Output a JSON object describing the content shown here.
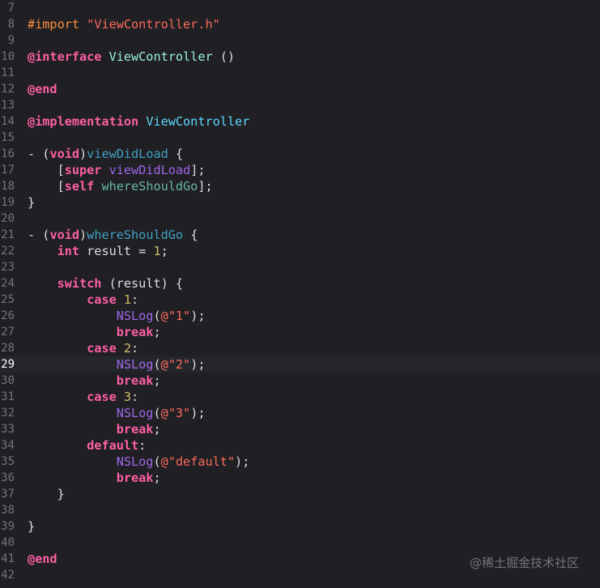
{
  "editor": {
    "current_line": 29,
    "first_line": 7,
    "lines": [
      [],
      [
        {
          "t": "#import ",
          "c": "pp"
        },
        {
          "t": "\"ViewController.h\"",
          "c": "str"
        }
      ],
      [],
      [
        {
          "t": "@interface",
          "c": "kw"
        },
        {
          "t": " ",
          "c": "txt"
        },
        {
          "t": "ViewController",
          "c": "tn"
        },
        {
          "t": " ()",
          "c": "txt"
        }
      ],
      [],
      [
        {
          "t": "@end",
          "c": "kw"
        }
      ],
      [],
      [
        {
          "t": "@implementation",
          "c": "kw"
        },
        {
          "t": " ",
          "c": "txt"
        },
        {
          "t": "ViewController",
          "c": "cls"
        }
      ],
      [],
      [
        {
          "t": "- (",
          "c": "txt"
        },
        {
          "t": "void",
          "c": "kw"
        },
        {
          "t": ")",
          "c": "txt"
        },
        {
          "t": "viewDidLoad",
          "c": "fdecl"
        },
        {
          "t": " {",
          "c": "txt"
        }
      ],
      [
        {
          "t": "    [",
          "c": "txt"
        },
        {
          "t": "super",
          "c": "kw"
        },
        {
          "t": " ",
          "c": "txt"
        },
        {
          "t": "viewDidLoad",
          "c": "sys"
        },
        {
          "t": "];",
          "c": "txt"
        }
      ],
      [
        {
          "t": "    [",
          "c": "txt"
        },
        {
          "t": "self",
          "c": "kw"
        },
        {
          "t": " ",
          "c": "txt"
        },
        {
          "t": "whereShouldGo",
          "c": "proj"
        },
        {
          "t": "];",
          "c": "txt"
        }
      ],
      [
        {
          "t": "}",
          "c": "txt"
        }
      ],
      [],
      [
        {
          "t": "- (",
          "c": "txt"
        },
        {
          "t": "void",
          "c": "kw"
        },
        {
          "t": ")",
          "c": "txt"
        },
        {
          "t": "whereShouldGo",
          "c": "fdecl"
        },
        {
          "t": " {",
          "c": "txt"
        }
      ],
      [
        {
          "t": "    ",
          "c": "txt"
        },
        {
          "t": "int",
          "c": "kw"
        },
        {
          "t": " result = ",
          "c": "txt"
        },
        {
          "t": "1",
          "c": "num"
        },
        {
          "t": ";",
          "c": "txt"
        }
      ],
      [],
      [
        {
          "t": "    ",
          "c": "txt"
        },
        {
          "t": "switch",
          "c": "kw"
        },
        {
          "t": " (result) {",
          "c": "txt"
        }
      ],
      [
        {
          "t": "        ",
          "c": "txt"
        },
        {
          "t": "case",
          "c": "kw"
        },
        {
          "t": " ",
          "c": "txt"
        },
        {
          "t": "1",
          "c": "num"
        },
        {
          "t": ":",
          "c": "txt"
        }
      ],
      [
        {
          "t": "            ",
          "c": "txt"
        },
        {
          "t": "NSLog",
          "c": "sys"
        },
        {
          "t": "(",
          "c": "txt"
        },
        {
          "t": "@\"1\"",
          "c": "str"
        },
        {
          "t": ");",
          "c": "txt"
        }
      ],
      [
        {
          "t": "            ",
          "c": "txt"
        },
        {
          "t": "break",
          "c": "kw"
        },
        {
          "t": ";",
          "c": "txt"
        }
      ],
      [
        {
          "t": "        ",
          "c": "txt"
        },
        {
          "t": "case",
          "c": "kw"
        },
        {
          "t": " ",
          "c": "txt"
        },
        {
          "t": "2",
          "c": "num"
        },
        {
          "t": ":",
          "c": "txt"
        }
      ],
      [
        {
          "t": "            ",
          "c": "txt"
        },
        {
          "t": "NSLog",
          "c": "sys"
        },
        {
          "t": "(",
          "c": "txt"
        },
        {
          "t": "@\"2\"",
          "c": "str"
        },
        {
          "t": ");",
          "c": "txt"
        }
      ],
      [
        {
          "t": "            ",
          "c": "txt"
        },
        {
          "t": "break",
          "c": "kw"
        },
        {
          "t": ";",
          "c": "txt"
        }
      ],
      [
        {
          "t": "        ",
          "c": "txt"
        },
        {
          "t": "case",
          "c": "kw"
        },
        {
          "t": " ",
          "c": "txt"
        },
        {
          "t": "3",
          "c": "num"
        },
        {
          "t": ":",
          "c": "txt"
        }
      ],
      [
        {
          "t": "            ",
          "c": "txt"
        },
        {
          "t": "NSLog",
          "c": "sys"
        },
        {
          "t": "(",
          "c": "txt"
        },
        {
          "t": "@\"3\"",
          "c": "str"
        },
        {
          "t": ");",
          "c": "txt"
        }
      ],
      [
        {
          "t": "            ",
          "c": "txt"
        },
        {
          "t": "break",
          "c": "kw"
        },
        {
          "t": ";",
          "c": "txt"
        }
      ],
      [
        {
          "t": "        ",
          "c": "txt"
        },
        {
          "t": "default",
          "c": "kw"
        },
        {
          "t": ":",
          "c": "txt"
        }
      ],
      [
        {
          "t": "            ",
          "c": "txt"
        },
        {
          "t": "NSLog",
          "c": "sys"
        },
        {
          "t": "(",
          "c": "txt"
        },
        {
          "t": "@\"default\"",
          "c": "str"
        },
        {
          "t": ");",
          "c": "txt"
        }
      ],
      [
        {
          "t": "            ",
          "c": "txt"
        },
        {
          "t": "break",
          "c": "kw"
        },
        {
          "t": ";",
          "c": "txt"
        }
      ],
      [
        {
          "t": "    }",
          "c": "txt"
        }
      ],
      [],
      [
        {
          "t": "}",
          "c": "txt"
        }
      ],
      [],
      [
        {
          "t": "@end",
          "c": "kw"
        }
      ],
      []
    ]
  },
  "watermark": "@稀土掘金技术社区"
}
